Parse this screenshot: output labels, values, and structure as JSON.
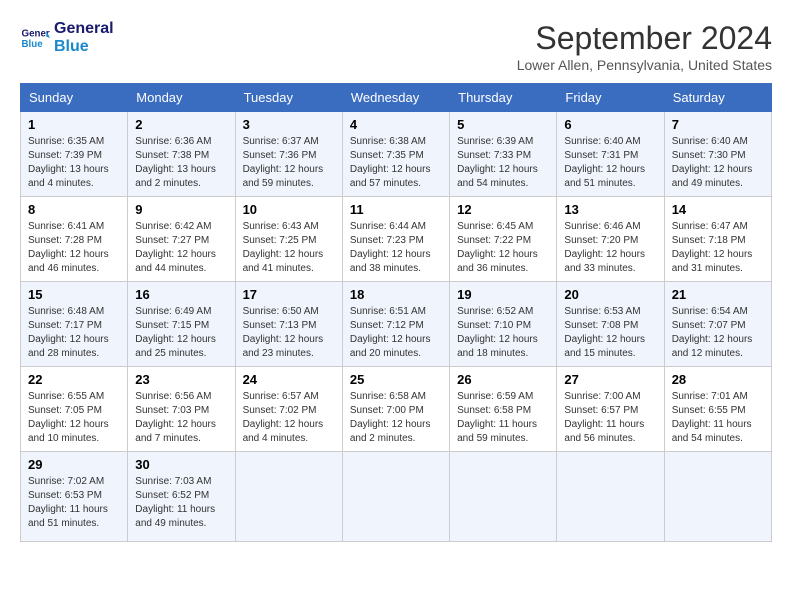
{
  "logo": {
    "line1": "General",
    "line2": "Blue"
  },
  "title": "September 2024",
  "location": "Lower Allen, Pennsylvania, United States",
  "weekdays": [
    "Sunday",
    "Monday",
    "Tuesday",
    "Wednesday",
    "Thursday",
    "Friday",
    "Saturday"
  ],
  "weeks": [
    [
      {
        "num": "1",
        "sunrise": "6:35 AM",
        "sunset": "7:39 PM",
        "daylight": "13 hours and 4 minutes."
      },
      {
        "num": "2",
        "sunrise": "6:36 AM",
        "sunset": "7:38 PM",
        "daylight": "13 hours and 2 minutes."
      },
      {
        "num": "3",
        "sunrise": "6:37 AM",
        "sunset": "7:36 PM",
        "daylight": "12 hours and 59 minutes."
      },
      {
        "num": "4",
        "sunrise": "6:38 AM",
        "sunset": "7:35 PM",
        "daylight": "12 hours and 57 minutes."
      },
      {
        "num": "5",
        "sunrise": "6:39 AM",
        "sunset": "7:33 PM",
        "daylight": "12 hours and 54 minutes."
      },
      {
        "num": "6",
        "sunrise": "6:40 AM",
        "sunset": "7:31 PM",
        "daylight": "12 hours and 51 minutes."
      },
      {
        "num": "7",
        "sunrise": "6:40 AM",
        "sunset": "7:30 PM",
        "daylight": "12 hours and 49 minutes."
      }
    ],
    [
      {
        "num": "8",
        "sunrise": "6:41 AM",
        "sunset": "7:28 PM",
        "daylight": "12 hours and 46 minutes."
      },
      {
        "num": "9",
        "sunrise": "6:42 AM",
        "sunset": "7:27 PM",
        "daylight": "12 hours and 44 minutes."
      },
      {
        "num": "10",
        "sunrise": "6:43 AM",
        "sunset": "7:25 PM",
        "daylight": "12 hours and 41 minutes."
      },
      {
        "num": "11",
        "sunrise": "6:44 AM",
        "sunset": "7:23 PM",
        "daylight": "12 hours and 38 minutes."
      },
      {
        "num": "12",
        "sunrise": "6:45 AM",
        "sunset": "7:22 PM",
        "daylight": "12 hours and 36 minutes."
      },
      {
        "num": "13",
        "sunrise": "6:46 AM",
        "sunset": "7:20 PM",
        "daylight": "12 hours and 33 minutes."
      },
      {
        "num": "14",
        "sunrise": "6:47 AM",
        "sunset": "7:18 PM",
        "daylight": "12 hours and 31 minutes."
      }
    ],
    [
      {
        "num": "15",
        "sunrise": "6:48 AM",
        "sunset": "7:17 PM",
        "daylight": "12 hours and 28 minutes."
      },
      {
        "num": "16",
        "sunrise": "6:49 AM",
        "sunset": "7:15 PM",
        "daylight": "12 hours and 25 minutes."
      },
      {
        "num": "17",
        "sunrise": "6:50 AM",
        "sunset": "7:13 PM",
        "daylight": "12 hours and 23 minutes."
      },
      {
        "num": "18",
        "sunrise": "6:51 AM",
        "sunset": "7:12 PM",
        "daylight": "12 hours and 20 minutes."
      },
      {
        "num": "19",
        "sunrise": "6:52 AM",
        "sunset": "7:10 PM",
        "daylight": "12 hours and 18 minutes."
      },
      {
        "num": "20",
        "sunrise": "6:53 AM",
        "sunset": "7:08 PM",
        "daylight": "12 hours and 15 minutes."
      },
      {
        "num": "21",
        "sunrise": "6:54 AM",
        "sunset": "7:07 PM",
        "daylight": "12 hours and 12 minutes."
      }
    ],
    [
      {
        "num": "22",
        "sunrise": "6:55 AM",
        "sunset": "7:05 PM",
        "daylight": "12 hours and 10 minutes."
      },
      {
        "num": "23",
        "sunrise": "6:56 AM",
        "sunset": "7:03 PM",
        "daylight": "12 hours and 7 minutes."
      },
      {
        "num": "24",
        "sunrise": "6:57 AM",
        "sunset": "7:02 PM",
        "daylight": "12 hours and 4 minutes."
      },
      {
        "num": "25",
        "sunrise": "6:58 AM",
        "sunset": "7:00 PM",
        "daylight": "12 hours and 2 minutes."
      },
      {
        "num": "26",
        "sunrise": "6:59 AM",
        "sunset": "6:58 PM",
        "daylight": "11 hours and 59 minutes."
      },
      {
        "num": "27",
        "sunrise": "7:00 AM",
        "sunset": "6:57 PM",
        "daylight": "11 hours and 56 minutes."
      },
      {
        "num": "28",
        "sunrise": "7:01 AM",
        "sunset": "6:55 PM",
        "daylight": "11 hours and 54 minutes."
      }
    ],
    [
      {
        "num": "29",
        "sunrise": "7:02 AM",
        "sunset": "6:53 PM",
        "daylight": "11 hours and 51 minutes."
      },
      {
        "num": "30",
        "sunrise": "7:03 AM",
        "sunset": "6:52 PM",
        "daylight": "11 hours and 49 minutes."
      },
      null,
      null,
      null,
      null,
      null
    ]
  ]
}
